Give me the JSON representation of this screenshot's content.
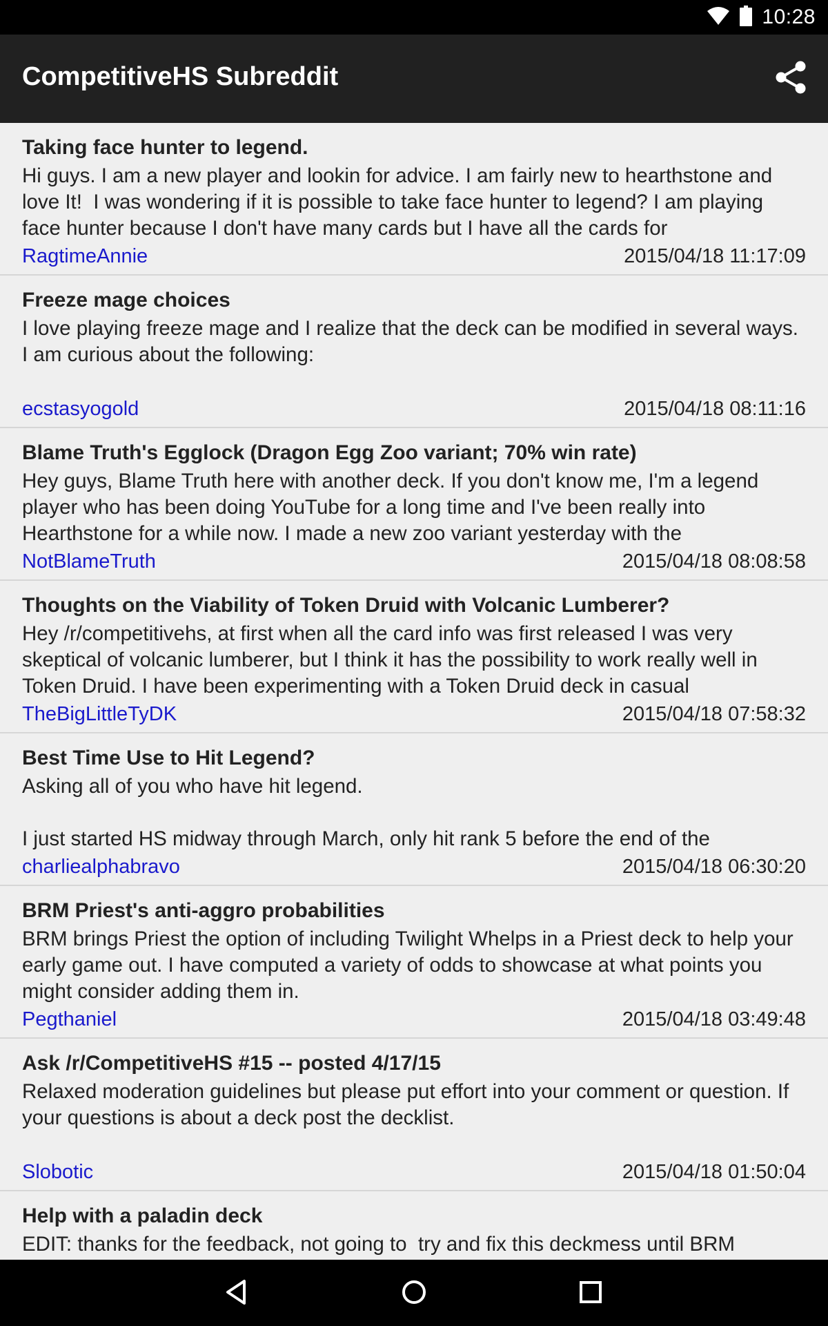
{
  "status_bar": {
    "time": "10:28",
    "icons": [
      "wifi-icon",
      "battery-icon"
    ]
  },
  "app_bar": {
    "title": "CompetitiveHS Subreddit",
    "action_icon": "share-icon"
  },
  "posts": [
    {
      "title": "Taking face hunter to legend.",
      "body": "Hi guys. I am a new player and lookin for advice. I am fairly new to hearthstone and love It!  I was wondering if it is possible to take face hunter to legend? I am playing face hunter because I don't have many cards but I have all the cards for",
      "author": "RagtimeAnnie",
      "date": "2015/04/18 11:17:09"
    },
    {
      "title": "Freeze mage choices",
      "body": "I love playing freeze mage and I realize that the deck can be modified in several ways. I am curious about the following:",
      "author": "ecstasyogold",
      "date": "2015/04/18 08:11:16"
    },
    {
      "title": "Blame Truth's Egglock (Dragon Egg Zoo variant; 70% win rate)",
      "body": "Hey guys, Blame Truth here with another deck. If you don't know me, I'm a legend player who has been doing YouTube for a long time and I've been really into Hearthstone for a while now. I made a new zoo variant yesterday with the",
      "author": "NotBlameTruth",
      "date": "2015/04/18 08:08:58"
    },
    {
      "title": "Thoughts on the Viability of Token Druid with Volcanic Lumberer?",
      "body": "Hey /r/competitivehs, at first when all the card info was first released I was very skeptical of volcanic lumberer, but I think it has the possibility to work really well in Token Druid. I have been experimenting with a Token Druid deck in casual",
      "author": "TheBigLittleTyDK",
      "date": "2015/04/18 07:58:32"
    },
    {
      "title": "Best Time Use to Hit Legend?",
      "body": "Asking all of you who have hit legend.\n\nI just started HS midway through March, only hit rank 5 before the end of the",
      "author": "charliealphabravo",
      "date": "2015/04/18 06:30:20"
    },
    {
      "title": "BRM Priest's anti-aggro probabilities",
      "body": "BRM brings Priest the option of including Twilight Whelps in a Priest deck to help your early game out. I have computed a variety of odds to showcase at what points you might consider adding them in.",
      "author": "Pegthaniel",
      "date": "2015/04/18 03:49:48"
    },
    {
      "title": "Ask /r/CompetitiveHS #15 -- posted 4/17/15",
      "body": "Relaxed moderation guidelines but please put effort into your comment or question. If your questions is about a deck post the decklist.",
      "author": "Slobotic",
      "date": "2015/04/18 01:50:04"
    },
    {
      "title": "Help with a paladin deck",
      "body": "EDIT: thanks for the feedback, not going to  try and fix this deckmess until BRM",
      "author": "",
      "date": ""
    }
  ],
  "nav_bar": {
    "icons": [
      "back-icon",
      "home-icon",
      "recents-icon"
    ]
  }
}
